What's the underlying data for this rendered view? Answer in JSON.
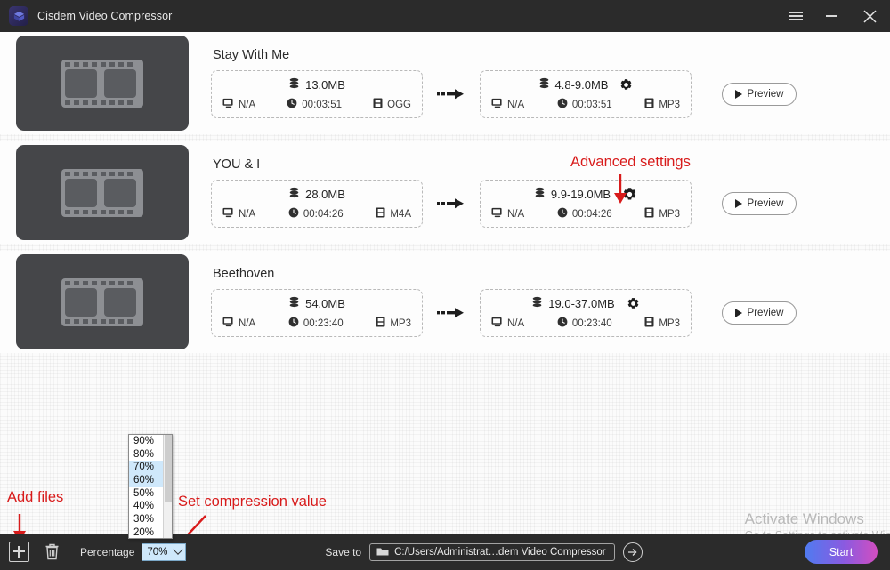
{
  "window": {
    "title": "Cisdem Video Compressor",
    "logo_icon": "cisdem-cube-icon",
    "menu_icon": "hamburger-menu-icon",
    "minimize_icon": "minimize-icon",
    "close_icon": "close-icon"
  },
  "files": [
    {
      "title": "Stay With Me",
      "thumb_icon": "film-strip-icon",
      "source": {
        "size": "13.0MB",
        "resolution": "N/A",
        "duration": "00:03:51",
        "format": "OGG",
        "size_icon": "database-icon",
        "resolution_icon": "monitor-icon",
        "duration_icon": "clock-icon",
        "format_icon": "film-icon"
      },
      "target": {
        "size": "4.8-9.0MB",
        "resolution": "N/A",
        "duration": "00:03:51",
        "format": "MP3",
        "settings_icon": "gear-icon"
      },
      "preview_label": "Preview"
    },
    {
      "title": "YOU & I",
      "thumb_icon": "film-strip-icon",
      "source": {
        "size": "28.0MB",
        "resolution": "N/A",
        "duration": "00:04:26",
        "format": "M4A",
        "size_icon": "database-icon",
        "resolution_icon": "monitor-icon",
        "duration_icon": "clock-icon",
        "format_icon": "film-icon"
      },
      "target": {
        "size": "9.9-19.0MB",
        "resolution": "N/A",
        "duration": "00:04:26",
        "format": "MP3",
        "settings_icon": "gear-icon"
      },
      "preview_label": "Preview"
    },
    {
      "title": "Beethoven",
      "thumb_icon": "film-strip-icon",
      "source": {
        "size": "54.0MB",
        "resolution": "N/A",
        "duration": "00:23:40",
        "format": "MP3",
        "size_icon": "database-icon",
        "resolution_icon": "monitor-icon",
        "duration_icon": "clock-icon",
        "format_icon": "film-icon"
      },
      "target": {
        "size": "19.0-37.0MB",
        "resolution": "N/A",
        "duration": "00:23:40",
        "format": "MP3",
        "settings_icon": "gear-icon"
      },
      "preview_label": "Preview"
    }
  ],
  "annotations": {
    "advanced_settings": "Advanced settings",
    "add_files": "Add files",
    "set_compression_value": "Set compression value",
    "color": "#d81b1b"
  },
  "dropdown": {
    "options": [
      "90%",
      "80%",
      "70%",
      "60%",
      "50%",
      "40%",
      "30%",
      "20%"
    ],
    "selected": "70%",
    "hovered": "60%"
  },
  "bottom_bar": {
    "add_icon": "add-files-icon",
    "delete_icon": "trash-icon",
    "percentage_label": "Percentage",
    "percentage_value": "70%",
    "chevron_icon": "chevron-down-icon",
    "save_to_label": "Save to",
    "folder_icon": "folder-icon",
    "save_path": "C:/Users/Administrat…dem Video Compressor",
    "go_icon": "arrow-right-circle-icon",
    "start_label": "Start"
  },
  "watermark": {
    "line1": "Activate Windows",
    "line2": "Go to Settings to activate Windows."
  }
}
